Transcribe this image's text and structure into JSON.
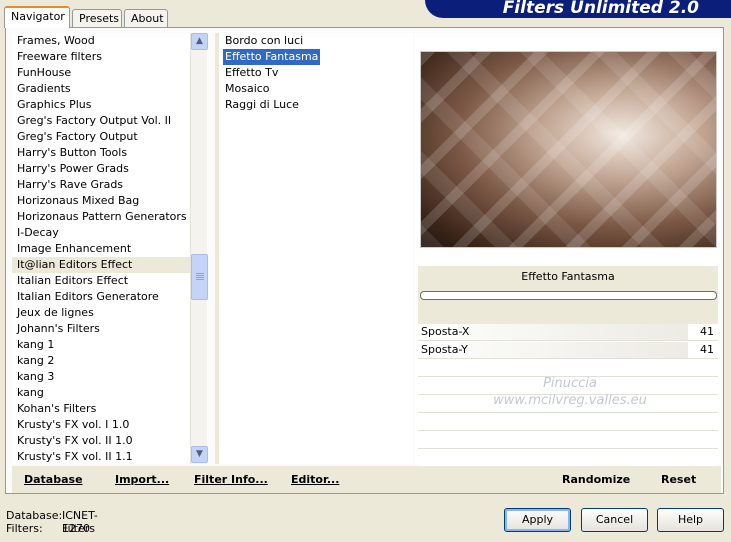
{
  "app_title": "Filters Unlimited 2.0",
  "tabs": [
    {
      "label": "Navigator",
      "active": true
    },
    {
      "label": "Presets",
      "active": false
    },
    {
      "label": "About",
      "active": false
    }
  ],
  "categories": [
    "Frames, Wood",
    "Freeware filters",
    "FunHouse",
    "Gradients",
    "Graphics Plus",
    "Greg's Factory Output Vol. II",
    "Greg's Factory Output",
    "Harry's Button Tools",
    "Harry's Power Grads",
    "Harry's Rave Grads",
    "Horizonaus Mixed Bag",
    "Horizonaus Pattern Generators",
    "I-Decay",
    "Image Enhancement",
    "It@lian Editors Effect",
    "Italian Editors Effect",
    "Italian Editors Generatore",
    "Jeux de lignes",
    "Johann's Filters",
    "kang 1",
    "kang 2",
    "kang 3",
    "kang",
    "Kohan's Filters",
    "Krusty's FX vol. I 1.0",
    "Krusty's FX vol. II 1.0",
    "Krusty's FX vol. II 1.1"
  ],
  "selected_category": "It@lian Editors Effect",
  "filters": [
    "Bordo con luci",
    "Effetto Fantasma",
    "Effetto Tv",
    "Mosaico",
    "Raggi di Luce"
  ],
  "selected_filter": "Effetto Fantasma",
  "filter_display_name": "Effetto Fantasma",
  "params": [
    {
      "label": "Sposta-X",
      "value": "41"
    },
    {
      "label": "Sposta-Y",
      "value": "41"
    }
  ],
  "watermark": {
    "line1": "Pinuccia",
    "line2": "www.mcilvreg.valles.eu"
  },
  "bottom_buttons": {
    "database": "Database",
    "import": "Import...",
    "filter_info": "Filter Info...",
    "editor": "Editor...",
    "randomize": "Randomize",
    "reset": "Reset"
  },
  "status": {
    "database_label": "Database:",
    "database_value": "ICNET-Filters",
    "filters_label": "Filters:",
    "filters_value": "1270"
  },
  "dialog_buttons": {
    "apply": "Apply",
    "cancel": "Cancel",
    "help": "Help"
  },
  "colors": {
    "accent": "#316ac5",
    "banner": "#0a1e7a",
    "face": "#ece9d8"
  }
}
